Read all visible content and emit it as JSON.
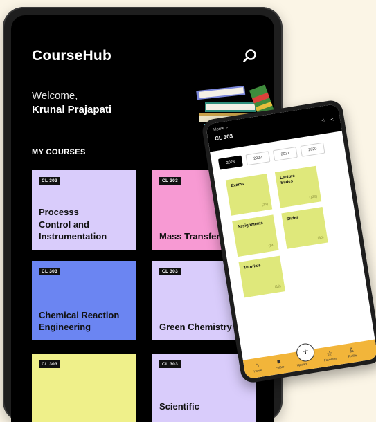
{
  "tablet": {
    "app_title": "CourseHub",
    "welcome_text": "Welcome,",
    "user_name": "Krunal Prajapati",
    "section_title": "MY COURSES",
    "courses": [
      {
        "code": "CL 303",
        "name": "Processs\nControl and\nInstrumentation",
        "color": "#d9ccfb"
      },
      {
        "code": "CL 303",
        "name": "Mass Transfer",
        "color": "#f79ad3"
      },
      {
        "code": "CL 303",
        "name": "Chemical Reaction\nEngineering",
        "color": "#6b85f2"
      },
      {
        "code": "CL 303",
        "name": "Green Chemistry",
        "color": "#d9ccfb"
      },
      {
        "code": "CL 303",
        "name": "",
        "color": "#eff08a"
      },
      {
        "code": "CL 303",
        "name": "Scientific",
        "color": "#d9ccfb"
      }
    ]
  },
  "phone": {
    "breadcrumb": "Home >",
    "course_code": "CL 303",
    "year_tabs": [
      "2023",
      "2022",
      "2021",
      "2020"
    ],
    "active_tab": "2023",
    "tiles": [
      {
        "label": "Exams",
        "count": "(25)"
      },
      {
        "label": "Lecture\nSlides",
        "count": "(120)"
      },
      {
        "label": "Assignments",
        "count": "(14)"
      },
      {
        "label": "Slides",
        "count": "(30)"
      },
      {
        "label": "Tutorials",
        "count": "(12)"
      }
    ],
    "nav": [
      {
        "icon": "home-icon",
        "label": "Home"
      },
      {
        "icon": "folder-icon",
        "label": "Folder"
      },
      {
        "icon": "plus-icon",
        "label": "Upload"
      },
      {
        "icon": "star-icon",
        "label": "Favorites"
      },
      {
        "icon": "person-icon",
        "label": "Profile"
      }
    ]
  },
  "colors": {
    "background": "#fbf5e6",
    "accent_nav": "#f2b53a",
    "tile": "#dfe87b"
  }
}
